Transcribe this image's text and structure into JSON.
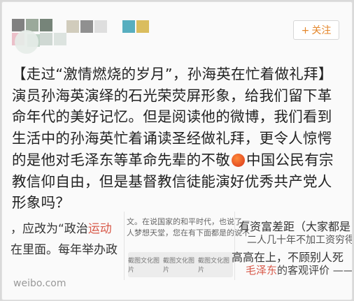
{
  "header": {
    "follow_button": {
      "icon": "plus-icon",
      "plus": "+",
      "label": "关注",
      "color": "#e4862a"
    },
    "mosaic_colors": [
      "#6b6b6b",
      "#8a9a8a",
      "#5e6e62",
      "#c9c3b0",
      "#7d7d7d",
      "#d8d8d8",
      "#3aa0b4",
      "#d4b242",
      "#d97a8f",
      "#7aa38a",
      "#9bb0a4",
      "#b7c7be"
    ]
  },
  "post": {
    "lines": [
      "【走过“激情燃烧的岁月”，孙海英在忙着做礼拜】",
      "演员孙海英演绎的石光荣荧屏形象，给我们留下革",
      "命年代的美好记忆。但是阅读他的微博，我们看到",
      "生活中的孙海英忙着诵读圣经做礼拜，更令人惊愕"
    ],
    "line5_before": "的是他对毛泽东等革命先辈的不敬",
    "emoji": "angry-face-icon",
    "line5_after": "中国公民有宗",
    "lines_rest": [
      "教信仰自由，但是基督教信徒能演好优秀共产党人",
      "形象吗？"
    ]
  },
  "collage": {
    "frag1_before": "，应改为“政治",
    "frag1_red": "运动",
    "frag2": "在里面。每年举办政",
    "small_a": "文。在说国家的和平时代，也说了一",
    "small_b": "人梦想天堂，您在有下面都是的说不",
    "mini_labels": [
      "截图文化图片",
      "截图文化图片",
      "截图文化图片"
    ],
    "right_a": "有资富差距（大家都是",
    "right_b": "二人几十年不加工资穷得",
    "right_c_before": "高高在上，不顾别人死",
    "right_d_red": "毛泽东",
    "right_d_after": "的客观评价 ——"
  },
  "watermark": "weibo.com"
}
